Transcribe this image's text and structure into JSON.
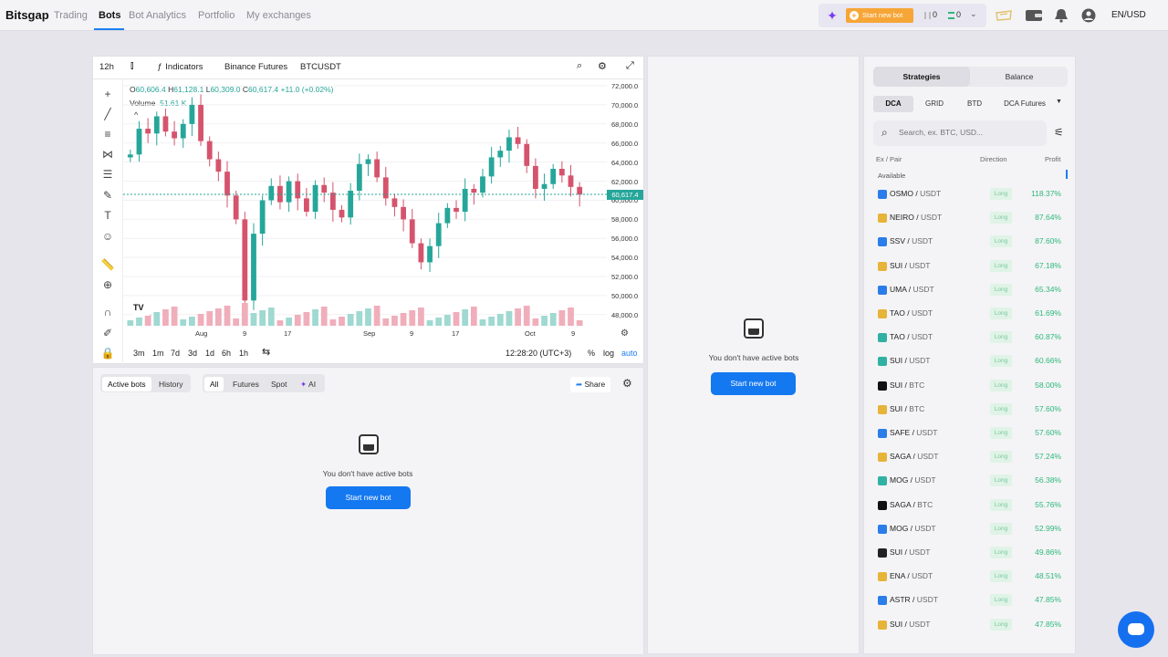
{
  "nav": {
    "logo": "Bitsgap",
    "items": [
      {
        "label": "Trading",
        "active": false
      },
      {
        "label": "Bots",
        "active": true
      },
      {
        "label": "Bot Analytics",
        "active": false
      },
      {
        "label": "Portfolio",
        "active": false
      },
      {
        "label": "My exchanges",
        "active": false
      }
    ],
    "start_bot_label": "Start new bot",
    "stat_a": "0",
    "stat_b": "0",
    "language": "EN/USD"
  },
  "chart": {
    "interval": "12h",
    "indicators_label": "Indicators",
    "exchange": "Binance Futures",
    "symbol": "BTCUSDT",
    "ohlc": {
      "open": "60,606.4",
      "high": "61,128.1",
      "low": "60,309.0",
      "close": "60,617.4",
      "change": "+11.0 (+0.02%)"
    },
    "volume_label": "Volume",
    "volume_value": "51.61 K",
    "current_price": "60,617.4",
    "y_ticks": [
      "72,000.0",
      "70,000.0",
      "68,000.0",
      "66,000.0",
      "64,000.0",
      "62,000.0",
      "60,000.0",
      "58,000.0",
      "56,000.0",
      "54,000.0",
      "52,000.0",
      "50,000.0",
      "48,000.0"
    ],
    "x_ticks": [
      "Aug",
      "9",
      "17",
      "Sep",
      "9",
      "17",
      "Oct",
      "9"
    ],
    "timeframes": [
      "3m",
      "1m",
      "7d",
      "3d",
      "1d",
      "6h",
      "1h"
    ],
    "clock": "12:28:20 (UTC+3)",
    "percent_label": "%",
    "log_label": "log",
    "auto_label": "auto",
    "colors": {
      "up": "#26a69a",
      "down": "#d5536c"
    }
  },
  "bots": {
    "tabs": [
      "Active bots",
      "History"
    ],
    "filters": [
      "All",
      "Futures",
      "Spot",
      "AI"
    ],
    "share_label": "Share",
    "empty_text": "You don't have active bots",
    "start_label": "Start new bot"
  },
  "mid": {
    "empty_text": "You don't have active bots",
    "start_label": "Start new bot"
  },
  "strategies": {
    "tabs": [
      "Strategies",
      "Balance"
    ],
    "subtabs": [
      "DCA",
      "GRID",
      "BTD",
      "DCA Futures"
    ],
    "search_placeholder": "Search, ex. BTC, USD...",
    "col_pair": "Ex / Pair",
    "col_direction": "Direction",
    "col_profit": "Profit",
    "available_label": "Available",
    "rows": [
      {
        "base": "OSMO",
        "quote": "USDT",
        "direction": "Long",
        "profit": "118.37%",
        "exchange": "blue"
      },
      {
        "base": "NEIRO",
        "quote": "USDT",
        "direction": "Long",
        "profit": "87.64%",
        "exchange": "gold"
      },
      {
        "base": "SSV",
        "quote": "USDT",
        "direction": "Long",
        "profit": "87.60%",
        "exchange": "blue"
      },
      {
        "base": "SUI",
        "quote": "USDT",
        "direction": "Long",
        "profit": "67.18%",
        "exchange": "gold"
      },
      {
        "base": "UMA",
        "quote": "USDT",
        "direction": "Long",
        "profit": "65.34%",
        "exchange": "blue"
      },
      {
        "base": "TAO",
        "quote": "USDT",
        "direction": "Long",
        "profit": "61.69%",
        "exchange": "gold"
      },
      {
        "base": "TAO",
        "quote": "USDT",
        "direction": "Long",
        "profit": "60.87%",
        "exchange": "teal"
      },
      {
        "base": "SUI",
        "quote": "USDT",
        "direction": "Long",
        "profit": "60.66%",
        "exchange": "teal"
      },
      {
        "base": "SUI",
        "quote": "BTC",
        "direction": "Long",
        "profit": "58.00%",
        "exchange": "black"
      },
      {
        "base": "SUI",
        "quote": "BTC",
        "direction": "Long",
        "profit": "57.60%",
        "exchange": "gold"
      },
      {
        "base": "SAFE",
        "quote": "USDT",
        "direction": "Long",
        "profit": "57.60%",
        "exchange": "blue"
      },
      {
        "base": "SAGA",
        "quote": "USDT",
        "direction": "Long",
        "profit": "57.24%",
        "exchange": "gold"
      },
      {
        "base": "MOG",
        "quote": "USDT",
        "direction": "Long",
        "profit": "56.38%",
        "exchange": "teal"
      },
      {
        "base": "SAGA",
        "quote": "BTC",
        "direction": "Long",
        "profit": "55.76%",
        "exchange": "black"
      },
      {
        "base": "MOG",
        "quote": "USDT",
        "direction": "Long",
        "profit": "52.99%",
        "exchange": "blue"
      },
      {
        "base": "SUI",
        "quote": "USDT",
        "direction": "Long",
        "profit": "49.86%",
        "exchange": "dark"
      },
      {
        "base": "ENA",
        "quote": "USDT",
        "direction": "Long",
        "profit": "48.51%",
        "exchange": "gold"
      },
      {
        "base": "ASTR",
        "quote": "USDT",
        "direction": "Long",
        "profit": "47.85%",
        "exchange": "blue"
      },
      {
        "base": "SUI",
        "quote": "USDT",
        "direction": "Long",
        "profit": "47.85%",
        "exchange": "gold"
      }
    ]
  }
}
